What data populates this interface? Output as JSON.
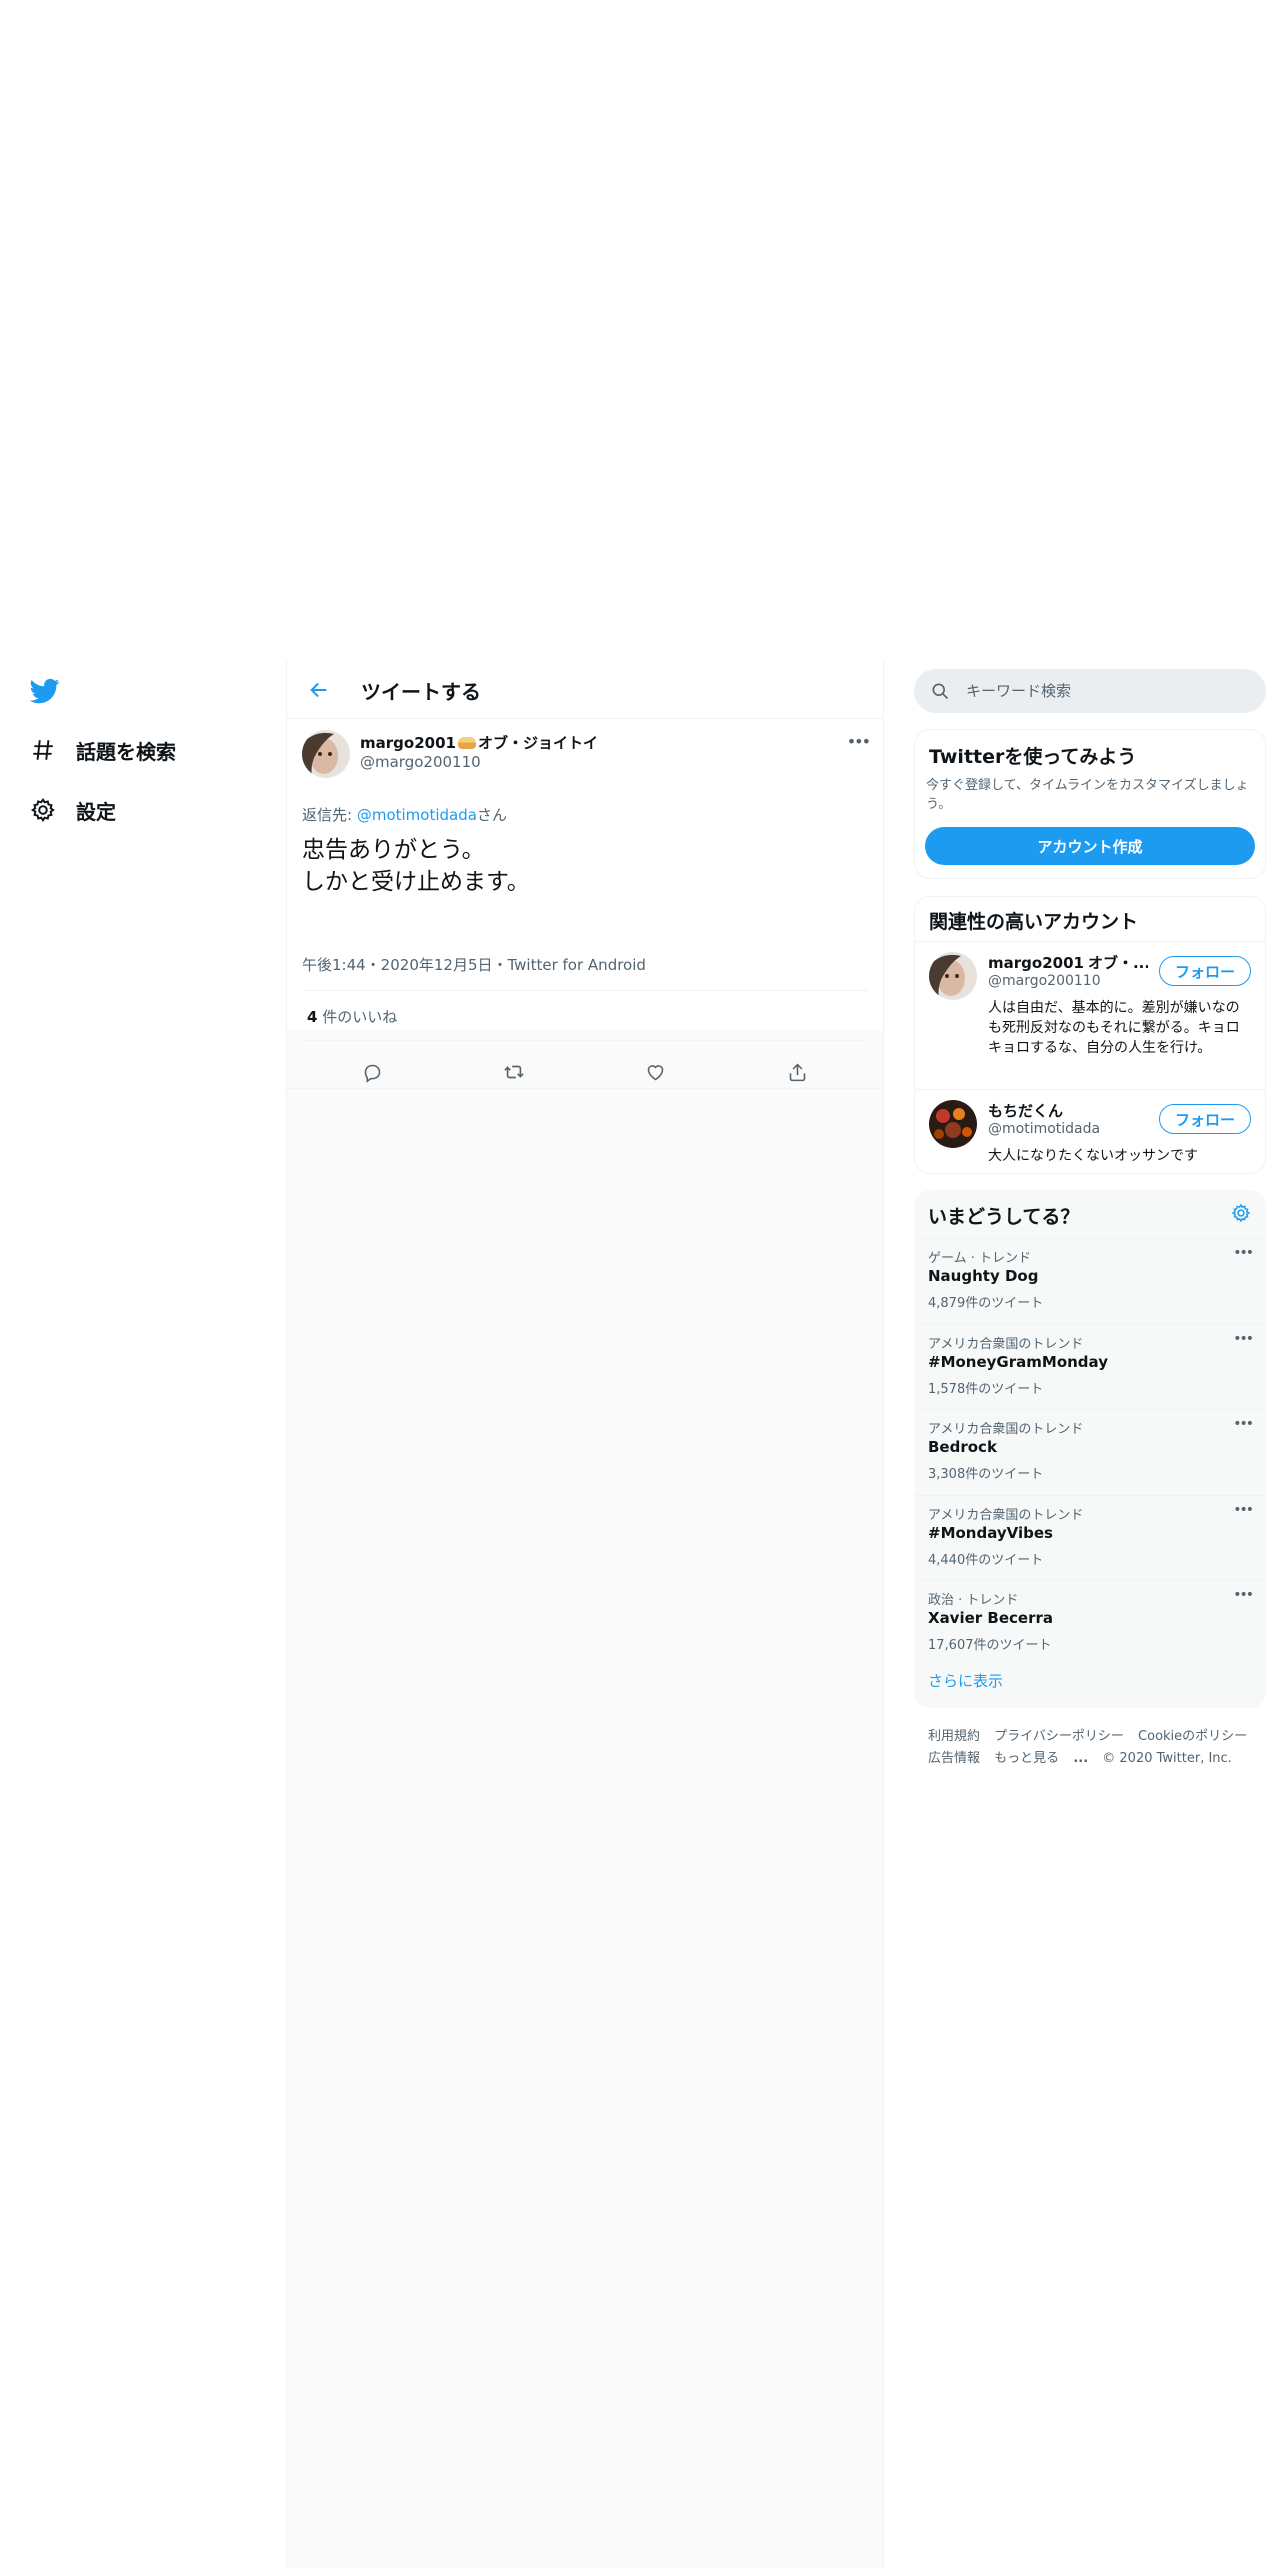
{
  "nav": {
    "items": [
      {
        "label": "話題を検索",
        "icon": "hashtag-icon"
      },
      {
        "label": "設定",
        "icon": "gear-icon"
      }
    ]
  },
  "header": {
    "title": "ツイートする"
  },
  "tweet": {
    "display_name_prefix": "margo2001",
    "display_name_suffix": "オブ・ジョイトイ",
    "handle": "@margo200110",
    "reply_prefix": "返信先: ",
    "reply_to": "@motimotidada",
    "reply_suffix": "さん",
    "text": "忠告ありがとう。\nしかと受け止めます。",
    "meta": "午後1:44・2020年12月5日・Twitter for Android",
    "like_count": "4",
    "like_label": " 件のいいね"
  },
  "search": {
    "placeholder": "キーワード検索"
  },
  "signup": {
    "title": "Twitterを使ってみよう",
    "description": "今すぐ登録して、タイムラインをカスタマイズしましょう。",
    "button": "アカウント作成"
  },
  "related": {
    "title": "関連性の高いアカウント",
    "follow_label": "フォロー",
    "accounts": [
      {
        "name": "margo2001",
        "name_suffix": "オブ・...",
        "handle": "@margo200110",
        "bio": "人は自由だ、基本的に。差別が嫌いなのも死刑反対なのもそれに繋がる。キョロキョロするな、自分の人生を行け。"
      },
      {
        "name": "もちだくん",
        "handle": "@motimotidada",
        "bio": "大人になりたくないオッサンです"
      }
    ]
  },
  "trends": {
    "title": "いまどうしてる？",
    "items": [
      {
        "context": "ゲーム · トレンド",
        "name": "Naughty Dog",
        "count": "4,879件のツイート"
      },
      {
        "context": "アメリカ合衆国のトレンド",
        "name": "#MoneyGramMonday",
        "count": "1,578件のツイート"
      },
      {
        "context": "アメリカ合衆国のトレンド",
        "name": "Bedrock",
        "count": "3,308件のツイート"
      },
      {
        "context": "アメリカ合衆国のトレンド",
        "name": "#MondayVibes",
        "count": "4,440件のツイート"
      },
      {
        "context": "政治 · トレンド",
        "name": "Xavier Becerra",
        "count": "17,607件のツイート"
      }
    ],
    "show_more": "さらに表示"
  },
  "footer": {
    "links": [
      "利用規約",
      "プライバシーポリシー",
      "Cookieのポリシー",
      "広告情報",
      "もっと見る"
    ],
    "more_dots": "...",
    "copyright": "© 2020 Twitter, Inc."
  },
  "colors": {
    "accent": "#1d9bf0",
    "text": "#0f1419",
    "secondary": "#536471",
    "border": "#eff3f4"
  }
}
